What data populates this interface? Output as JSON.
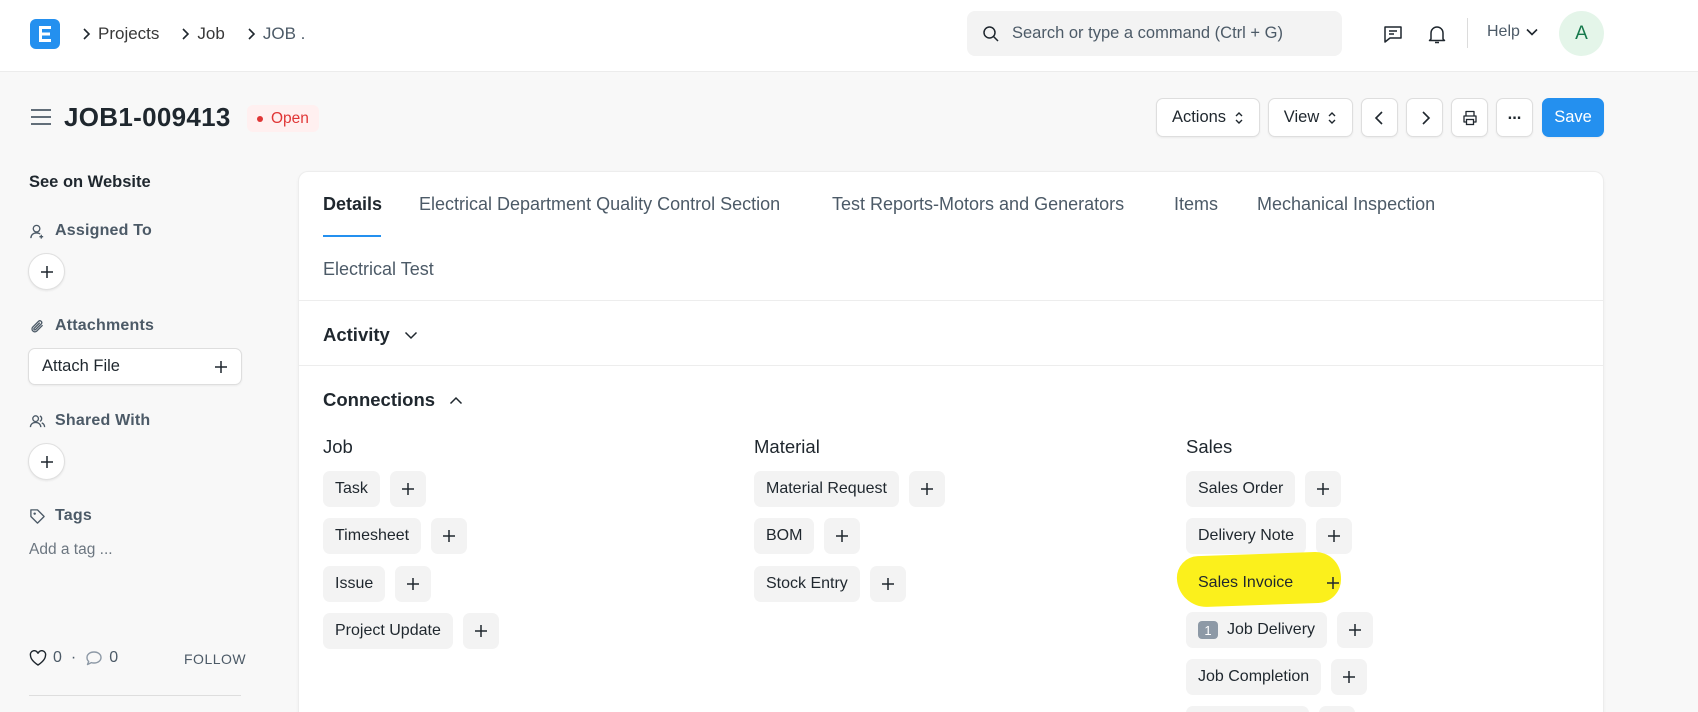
{
  "navbar": {
    "logo_letter": "E",
    "breadcrumbs": [
      "Projects",
      "Job",
      "JOB ."
    ],
    "search_placeholder": "Search or type a command (Ctrl + G)",
    "help_label": "Help",
    "avatar_letter": "A"
  },
  "page": {
    "title": "JOB1-009413",
    "status": "Open",
    "status_color": "#e03636",
    "actions_label": "Actions",
    "view_label": "View",
    "more_label": "...",
    "save_label": "Save",
    "primary_color": "#2490ef"
  },
  "sidebar": {
    "see_on_website": "See on Website",
    "assigned_to": "Assigned To",
    "attachments": "Attachments",
    "attach_file": "Attach File",
    "shared_with": "Shared With",
    "tags": "Tags",
    "add_tag": "Add a tag ...",
    "likes": "0",
    "comments": "0",
    "follow": "FOLLOW"
  },
  "tabs": [
    {
      "label": "Details",
      "active": true
    },
    {
      "label": "Electrical Department Quality Control Section",
      "active": false
    },
    {
      "label": "Test Reports-Motors and Generators",
      "active": false
    },
    {
      "label": "Items",
      "active": false
    },
    {
      "label": "Mechanical Inspection",
      "active": false
    },
    {
      "label": "Electrical Test",
      "active": false
    }
  ],
  "sections": {
    "activity": "Activity",
    "connections": "Connections"
  },
  "connections": {
    "job": {
      "title": "Job",
      "items": [
        "Task",
        "Timesheet",
        "Issue",
        "Project Update"
      ]
    },
    "material": {
      "title": "Material",
      "items": [
        "Material Request",
        "BOM",
        "Stock Entry"
      ]
    },
    "sales": {
      "title": "Sales",
      "items": [
        "Sales Order",
        "Delivery Note",
        "Sales Invoice",
        "Job Delivery",
        "Job Completion"
      ],
      "job_delivery_count": "1",
      "highlighted": "Sales Invoice",
      "highlight_color": "#fbf01c"
    }
  },
  "icons": [
    "logo-icon",
    "chevron-right-icon",
    "search-icon",
    "chat-icon",
    "bell-icon",
    "chevron-down-icon",
    "sort-icon",
    "chevron-left-icon",
    "printer-icon",
    "menu-icon",
    "user-plus-icon",
    "paperclip-icon",
    "users-icon",
    "tag-icon",
    "plus-icon",
    "heart-icon",
    "comment-icon",
    "chevron-up-icon"
  ]
}
